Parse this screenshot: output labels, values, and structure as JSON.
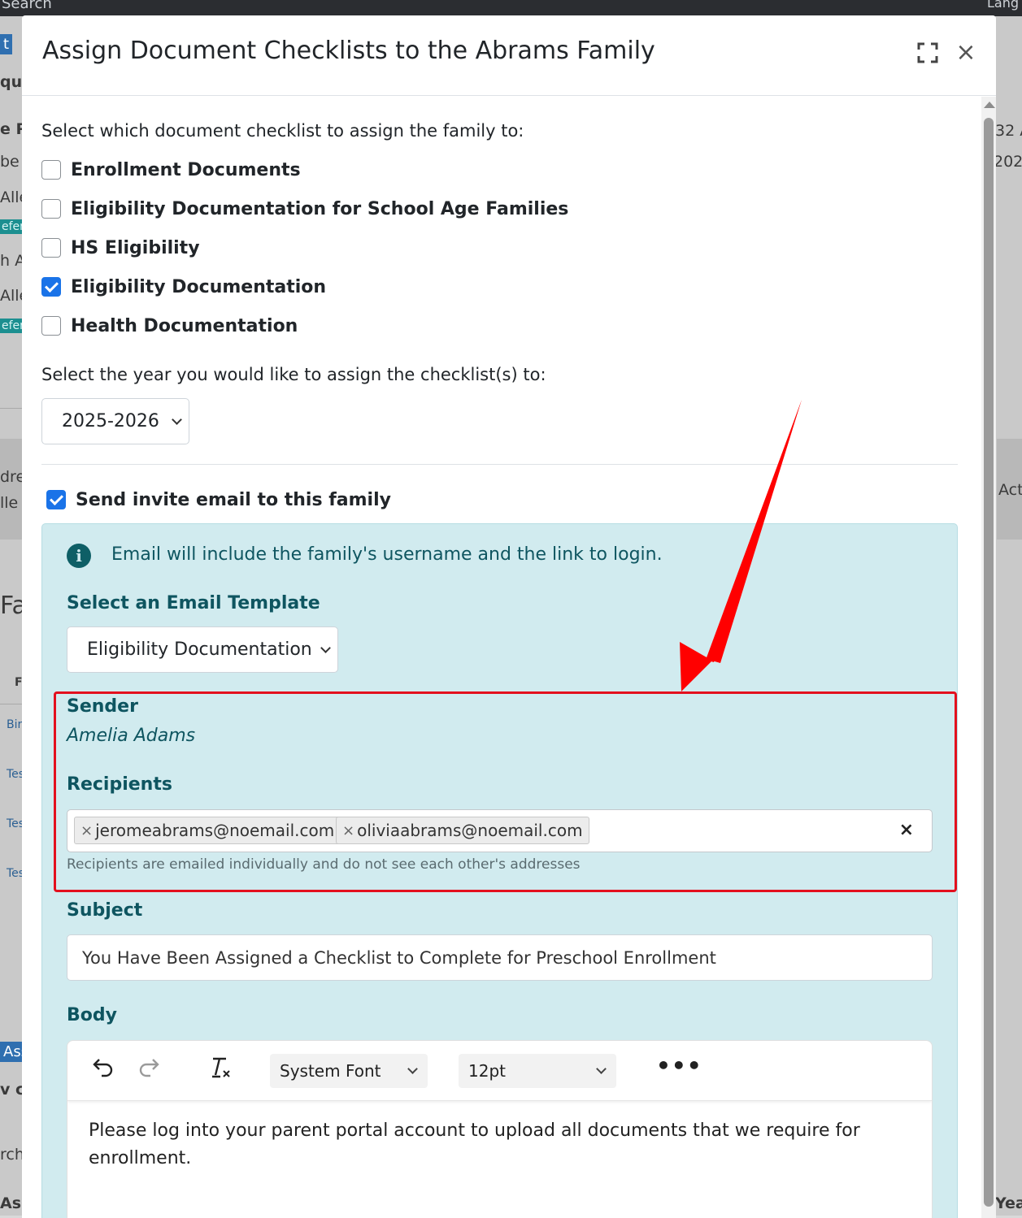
{
  "background": {
    "search_label": "Search",
    "language_label": "Lang"
  },
  "modal": {
    "title": "Assign Document Checklists to the Abrams Family",
    "checklist_prompt": "Select which document checklist to assign the family to:",
    "checklists": [
      {
        "label": "Enrollment Documents",
        "checked": false
      },
      {
        "label": "Eligibility Documentation for School Age Families",
        "checked": false
      },
      {
        "label": "HS Eligibility",
        "checked": false
      },
      {
        "label": "Eligibility Documentation",
        "checked": true
      },
      {
        "label": "Health Documentation",
        "checked": false
      }
    ],
    "year_prompt": "Select the year you would like to assign the checklist(s) to:",
    "year_selected": "2025-2026",
    "send_invite": {
      "label": "Send invite email to this family",
      "checked": true
    },
    "info_text": "Email will include the family's username and the link to login.",
    "template_heading": "Select an Email Template",
    "template_selected": "Eligibility Documentation",
    "sender_heading": "Sender",
    "sender_name": "Amelia Adams",
    "recipients_heading": "Recipients",
    "recipients": [
      "jeromeabrams@noemail.com",
      "oliviaabrams@noemail.com"
    ],
    "recipients_help": "Recipients are emailed individually and do not see each other's addresses",
    "subject_heading": "Subject",
    "subject_value": "You Have Been Assigned a Checklist to Complete for Preschool Enrollment",
    "body_heading": "Body",
    "editor": {
      "font_family": "System Font",
      "font_size": "12pt",
      "content": "Please log into your parent portal account to upload all documents that we require for enrollment."
    }
  },
  "colors": {
    "highlight": "#e3101e",
    "info_panel": "#d1ebef",
    "checkbox_checked": "#1a73e8"
  }
}
